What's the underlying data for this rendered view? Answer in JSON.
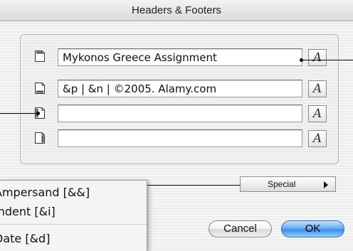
{
  "dialog": {
    "title": "Headers & Footers"
  },
  "fields": [
    {
      "value": "Mykonos Greece Assignment",
      "icon": "header-page-icon",
      "font_button": "A"
    },
    {
      "value": "&p | &n | ©2005. Alamy.com",
      "icon": "footer-page-icon",
      "font_button": "A"
    },
    {
      "value": "",
      "icon": "left-margin-page-icon",
      "font_button": "A"
    },
    {
      "value": "",
      "icon": "right-margin-page-icon",
      "font_button": "A"
    }
  ],
  "special": {
    "label": "Special"
  },
  "buttons": {
    "cancel": "Cancel",
    "ok": "OK"
  },
  "special_menu": {
    "items": [
      "Ampersand [&&]",
      "Indent [&i]",
      "Date [&d]"
    ]
  }
}
